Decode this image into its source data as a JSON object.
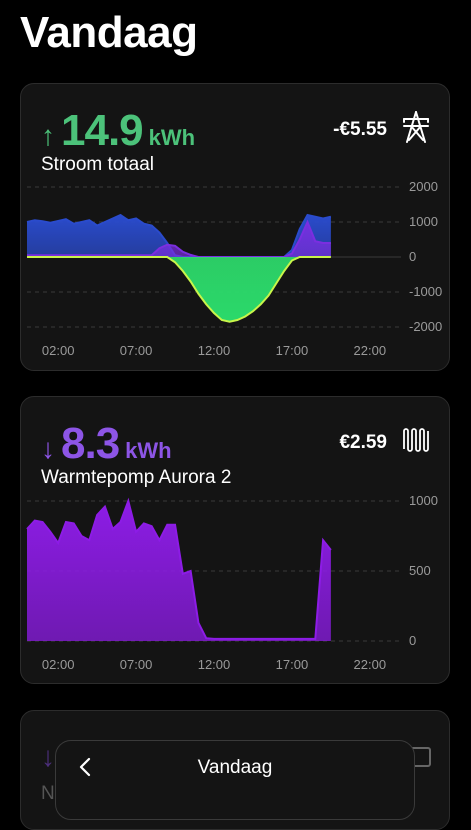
{
  "page": {
    "title": "Vandaag"
  },
  "cards": [
    {
      "direction_icon": "arrow-up-icon",
      "value": "14.9",
      "unit": "kWh",
      "label": "Stroom totaal",
      "cost": "-€5.55",
      "icon": "power-pylon-icon",
      "accent": "#4cc27a"
    },
    {
      "direction_icon": "arrow-down-icon",
      "value": "8.3",
      "unit": "kWh",
      "label": "Warmtepomp Aurora 2",
      "cost": "€2.59",
      "icon": "heater-radiator-icon",
      "accent": "#8d55e6"
    }
  ],
  "arrows": {
    "up": "↑",
    "down": "↓"
  },
  "bottom_sheet": {
    "title": "Vandaag",
    "back_icon": "chevron-left-icon",
    "partial_letter": "N"
  },
  "chart_data": [
    {
      "type": "area",
      "title": "Stroom totaal",
      "x_ticks": [
        "02:00",
        "07:00",
        "12:00",
        "17:00",
        "22:00"
      ],
      "y_ticks": [
        "2000",
        "1000",
        "0",
        "-1000",
        "-2000"
      ],
      "ylim": [
        -2000,
        2000
      ],
      "grid": true,
      "x": [
        0,
        0.5,
        1,
        1.5,
        2,
        2.5,
        3,
        3.5,
        4,
        4.5,
        5,
        5.5,
        6,
        6.5,
        7,
        7.5,
        8,
        8.5,
        9,
        9.5,
        10,
        10.5,
        11,
        11.5,
        12,
        12.5,
        13,
        13.5,
        14,
        14.5,
        15,
        15.5,
        16,
        16.5,
        17,
        17.5,
        18,
        18.5,
        19,
        19.5
      ],
      "series": [
        {
          "name": "net-blue",
          "color": "#2a4bcc",
          "values": [
            1000,
            1050,
            1020,
            980,
            1030,
            1080,
            950,
            1000,
            1050,
            900,
            1000,
            1100,
            1200,
            1050,
            1100,
            950,
            900,
            700,
            400,
            50,
            0,
            0,
            0,
            0,
            0,
            0,
            0,
            0,
            0,
            0,
            0,
            0,
            0,
            0,
            200,
            800,
            1200,
            1150,
            1100,
            1150
          ]
        },
        {
          "name": "consumption-purple",
          "color": "#7b2ee0",
          "values": [
            50,
            50,
            50,
            50,
            50,
            50,
            50,
            50,
            50,
            50,
            50,
            50,
            50,
            50,
            50,
            50,
            50,
            250,
            350,
            320,
            150,
            60,
            0,
            0,
            0,
            0,
            0,
            0,
            0,
            0,
            0,
            0,
            0,
            0,
            100,
            500,
            1000,
            450,
            400,
            400
          ]
        },
        {
          "name": "solar-green",
          "color": "#2ee06e",
          "values": [
            0,
            0,
            0,
            0,
            0,
            0,
            0,
            0,
            0,
            0,
            0,
            0,
            0,
            0,
            0,
            0,
            0,
            0,
            0,
            -150,
            -400,
            -700,
            -1050,
            -1350,
            -1600,
            -1800,
            -1850,
            -1800,
            -1700,
            -1550,
            -1350,
            -1100,
            -750,
            -400,
            -100,
            0,
            0,
            0,
            0,
            0
          ]
        }
      ]
    },
    {
      "type": "area",
      "title": "Warmtepomp Aurora 2",
      "x_ticks": [
        "02:00",
        "07:00",
        "12:00",
        "17:00",
        "22:00"
      ],
      "y_ticks": [
        "1000",
        "500",
        "0"
      ],
      "ylim": [
        0,
        1000
      ],
      "grid": true,
      "x": [
        0,
        0.5,
        1,
        1.5,
        2,
        2.5,
        3,
        3.5,
        4,
        4.5,
        5,
        5.5,
        6,
        6.5,
        7,
        7.5,
        8,
        8.5,
        9,
        9.5,
        10,
        10.5,
        11,
        11.5,
        12,
        12.5,
        13,
        13.5,
        14,
        14.5,
        15,
        15.5,
        16,
        16.5,
        17,
        17.5,
        18,
        18.5,
        19,
        19.5
      ],
      "series": [
        {
          "name": "heat-pump",
          "color": "#8d1ce6",
          "values": [
            800,
            860,
            850,
            780,
            700,
            850,
            840,
            750,
            720,
            900,
            960,
            800,
            850,
            1000,
            780,
            840,
            820,
            720,
            830,
            830,
            480,
            500,
            130,
            20,
            15,
            15,
            15,
            15,
            15,
            15,
            15,
            15,
            15,
            15,
            15,
            15,
            15,
            15,
            720,
            650
          ]
        }
      ]
    }
  ]
}
